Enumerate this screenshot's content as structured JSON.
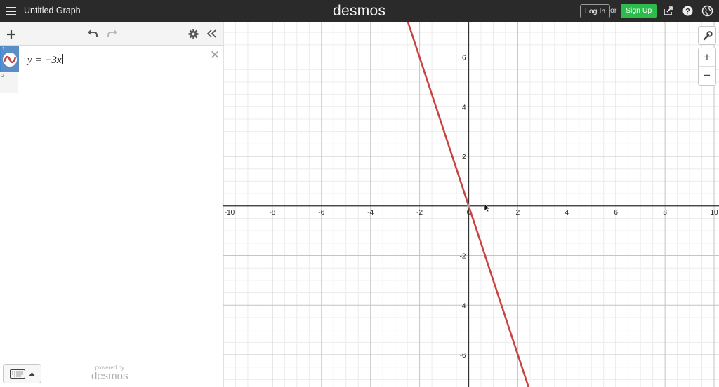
{
  "header": {
    "title": "Untitled Graph",
    "logo": "desmos",
    "login_label": "Log In",
    "or_label": "or",
    "signup_label": "Sign Up",
    "icons": [
      "menu-icon",
      "share-icon",
      "help-icon",
      "globe-icon"
    ]
  },
  "panel": {
    "toolbar_icons": [
      "add-icon",
      "undo-icon",
      "redo-icon",
      "settings-icon",
      "collapse-icon"
    ],
    "expressions": [
      {
        "number": "1",
        "latex": "y = −3x",
        "color": "#c74440"
      },
      {
        "number": "2",
        "latex": ""
      }
    ],
    "powered_by": "powered by",
    "powered_logo": "desmos"
  },
  "graph": {
    "x_ticks": [
      "-10",
      "-8",
      "-6",
      "-4",
      "-2",
      "0",
      "2",
      "4",
      "6",
      "8",
      "10"
    ],
    "y_ticks": [
      "6",
      "4",
      "2",
      "-2",
      "-4",
      "-6"
    ],
    "xlim": [
      -10,
      10.2
    ],
    "ylim": [
      -7.3,
      7.4
    ],
    "line_color": "#c74440",
    "side_buttons": [
      "wrench-icon",
      "zoom-in-icon",
      "zoom-out-icon"
    ],
    "zoom_in_label": "+",
    "zoom_out_label": "−"
  },
  "chart_data": {
    "type": "line",
    "title": "",
    "xlabel": "",
    "ylabel": "",
    "xlim": [
      -10,
      10.2
    ],
    "ylim": [
      -7.3,
      7.4
    ],
    "grid": true,
    "series": [
      {
        "name": "y = −3x",
        "x": [
          -2.47,
          2.47
        ],
        "y": [
          7.4,
          -7.4
        ],
        "color": "#c74440"
      }
    ]
  }
}
